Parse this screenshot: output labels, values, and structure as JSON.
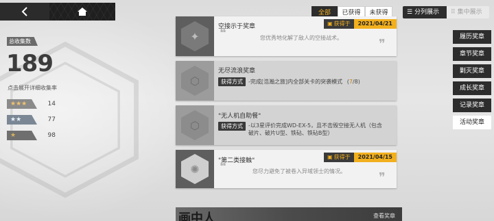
{
  "nav": {
    "back_icon": "chevron-left-icon",
    "home_icon": "home-icon"
  },
  "filters": {
    "all": "全部",
    "obtained": "已获得",
    "not_obtained": "未获得"
  },
  "view": {
    "split": "分列展示",
    "grouped": "集中展示"
  },
  "stats": {
    "label": "总收集数",
    "count": "189",
    "hint": "点击展开详细收集率",
    "rows": [
      {
        "stars": "★★★",
        "value": "14"
      },
      {
        "stars": "★★",
        "value": "77"
      },
      {
        "stars": "★",
        "value": "98"
      }
    ]
  },
  "cards": [
    {
      "title": "空接示于奖章",
      "desc": "您优秀地化解了敌人的空接战术。",
      "earned_label": "获得于",
      "earned_date": "2021/04/21"
    },
    {
      "title": "无尽流浪奖章",
      "method_label": "获得方式",
      "method_text": "-完成[浩瀚之旅]内全部关卡的突袭模式",
      "progress_done": "7",
      "progress_total": "/8)",
      "progress_open": "("
    },
    {
      "title": "\"无人机自助餐\"",
      "method_label": "获得方式",
      "method_text": "-以3星评价完成WD-EX-5，且不击毁空接无人机（包含",
      "method_text2": "破片、破片U型、铁砧、铁砧B型）"
    },
    {
      "title": "\"第二类接触\"",
      "desc": "您尽力避免了被卷入异域领士的情况。",
      "earned_label": "获得于",
      "earned_date": "2021/04/15"
    }
  ],
  "categories": [
    "履历奖章",
    "章节奖章",
    "剿灭奖章",
    "成长奖章",
    "记录奖章",
    "活动奖章"
  ],
  "banner": {
    "text": "画中人",
    "link": "查看奖章"
  },
  "colors": {
    "accent": "#f2b01e",
    "dark": "#2d2d2d"
  }
}
